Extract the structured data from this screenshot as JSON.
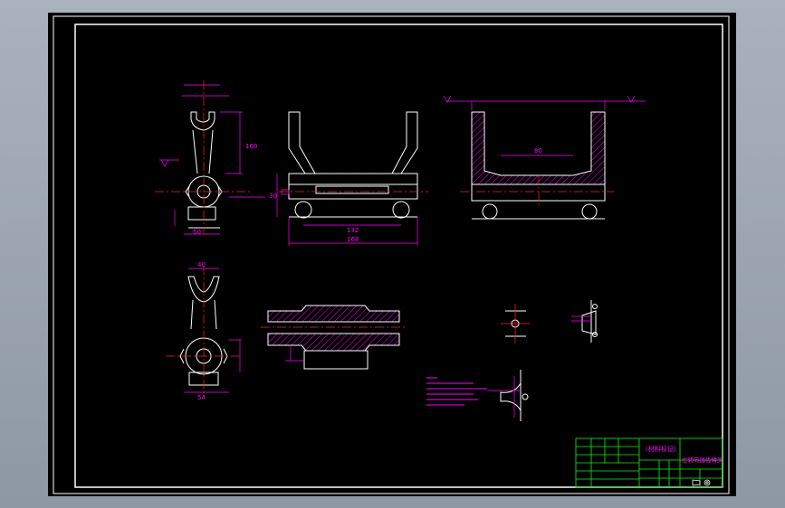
{
  "colors": {
    "background": "#000000",
    "frame": "#ffffff",
    "outline": "#ffffff",
    "dimension": "#ff00ff",
    "centerline": "#ff2020",
    "hatch": "#ff00ff",
    "notes": "#ff00ff",
    "titleblock": "#00ff00"
  },
  "dimensions": {
    "v1_height": "160",
    "v1_width": "50",
    "v2_inner": "132",
    "v2_total": "168",
    "v2_side": "30",
    "v3_inner": "80",
    "v4_top": "40",
    "v4_bottom": "54"
  },
  "titleblock": {
    "material": "(材料标记)",
    "part_name": "左转向器齿臂叉"
  }
}
